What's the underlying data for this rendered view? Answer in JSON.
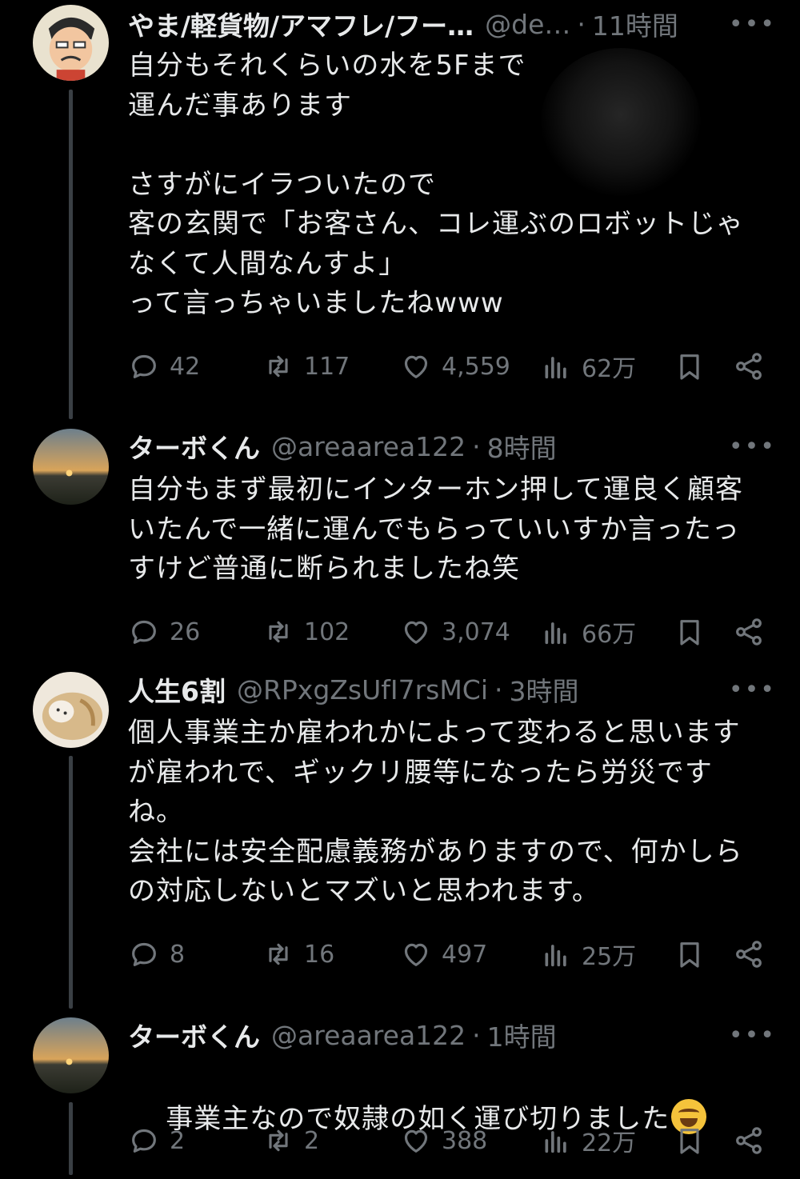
{
  "tweets": [
    {
      "name": "やま/軽貨物/アマフレ/フー…",
      "handle": "@de…",
      "time": "11時間",
      "text": "自分もそれくらいの水を5Fまで\n運んだ事あります\n\nさすがにイラついたので\n客の玄関で「お客さん、コレ運ぶのロボットじゃ\nなくて人間なんすよ」\nって言っちゃいましたねwww",
      "replies": "42",
      "retweets": "117",
      "likes": "4,559",
      "views": "62万"
    },
    {
      "name": "ターボくん",
      "handle": "@areaarea122",
      "time": "8時間",
      "text": "自分もまず最初にインターホン押して運良く顧客\nいたんで一緒に運んでもらっていいすか言ったっ\nすけど普通に断られましたね笑",
      "replies": "26",
      "retweets": "102",
      "likes": "3,074",
      "views": "66万"
    },
    {
      "name": "人生6割",
      "handle": "@RPxgZsUfI7rsMCi",
      "time": "3時間",
      "text": "個人事業主か雇われかによって変わると思います\nが雇われで、ギックリ腰等になったら労災です\nね。\n会社には安全配慮義務がありますので、何かしら\nの対応しないとマズいと思われます。",
      "replies": "8",
      "retweets": "16",
      "likes": "497",
      "views": "25万"
    },
    {
      "name": "ターボくん",
      "handle": "@areaarea122",
      "time": "1時間",
      "text": "事業主なので奴隷の如く運び切りました",
      "emoji": "face-with-tears-of-joy",
      "replies": "2",
      "retweets": "2",
      "likes": "388",
      "views": "22万"
    }
  ],
  "header": {
    "separator": "·",
    "more": "•••"
  },
  "colors": {
    "background": "#000000",
    "text": "#e7e9ea",
    "muted": "#71767b"
  }
}
